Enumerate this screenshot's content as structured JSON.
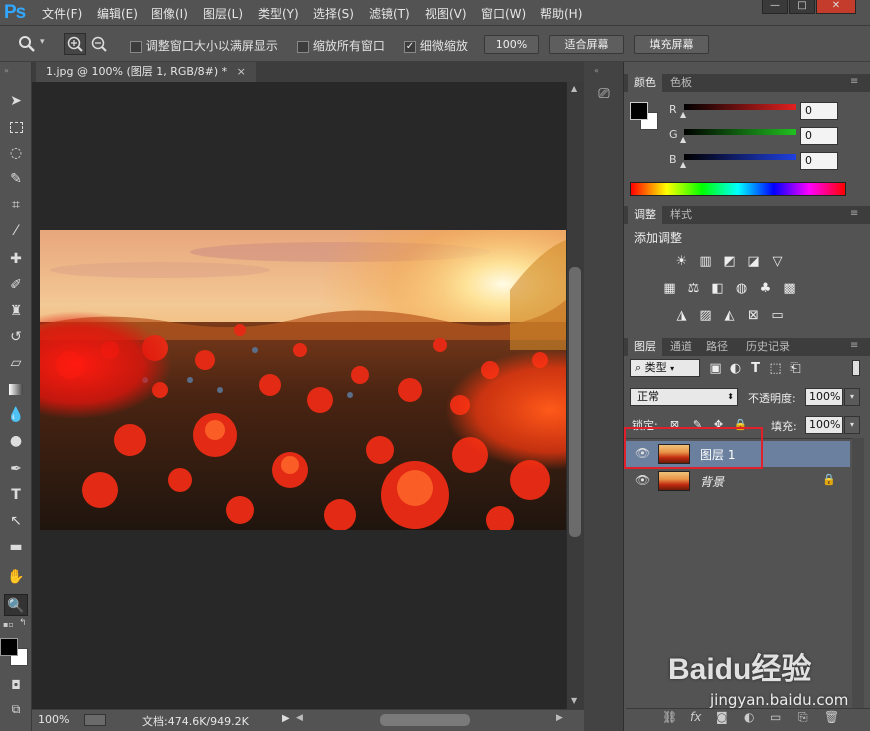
{
  "app": {
    "logo": "Ps"
  },
  "menu": [
    "文件(F)",
    "编辑(E)",
    "图像(I)",
    "图层(L)",
    "类型(Y)",
    "选择(S)",
    "滤镜(T)",
    "视图(V)",
    "窗口(W)",
    "帮助(H)"
  ],
  "window_buttons": [
    "—",
    "□",
    "✕"
  ],
  "options": {
    "resize_windows": "调整窗口大小以满屏显示",
    "zoom_all": "缩放所有窗口",
    "scrubby_zoom": "细微缩放",
    "scrubby_checked": true,
    "pct_button": "100%",
    "fit_screen": "适合屏幕",
    "fill_screen": "填充屏幕"
  },
  "document": {
    "tab_title": "1.jpg @ 100% (图层 1, RGB/8#) *",
    "close": "×"
  },
  "status": {
    "zoom": "100%",
    "doc_info": "文档:474.6K/949.2K"
  },
  "color_panel": {
    "tabs": [
      "颜色",
      "色板"
    ],
    "channels": [
      {
        "label": "R",
        "value": "0",
        "color": "#e02020"
      },
      {
        "label": "G",
        "value": "0",
        "color": "#20c020"
      },
      {
        "label": "B",
        "value": "0",
        "color": "#2040e0"
      }
    ]
  },
  "adjustments_panel": {
    "tabs": [
      "调整",
      "样式"
    ],
    "title": "添加调整"
  },
  "layers_panel": {
    "tabs": [
      "图层",
      "通道",
      "路径",
      "历史记录"
    ],
    "filter_kind": "类型",
    "blend_mode": "正常",
    "opacity_label": "不透明度:",
    "opacity": "100%",
    "lock_label": "锁定:",
    "fill_label": "填充:",
    "fill": "100%",
    "layers": [
      {
        "name": "图层 1",
        "selected": true,
        "locked": false
      },
      {
        "name": "背景",
        "selected": false,
        "locked": true
      }
    ]
  },
  "watermark": {
    "brand": "Baidu经验",
    "url": "jingyan.baidu.com"
  },
  "colors": {
    "selection_highlight": "#6b7f9e",
    "annotation_box": "#e0202b",
    "ps_blue": "#31a8ff"
  }
}
